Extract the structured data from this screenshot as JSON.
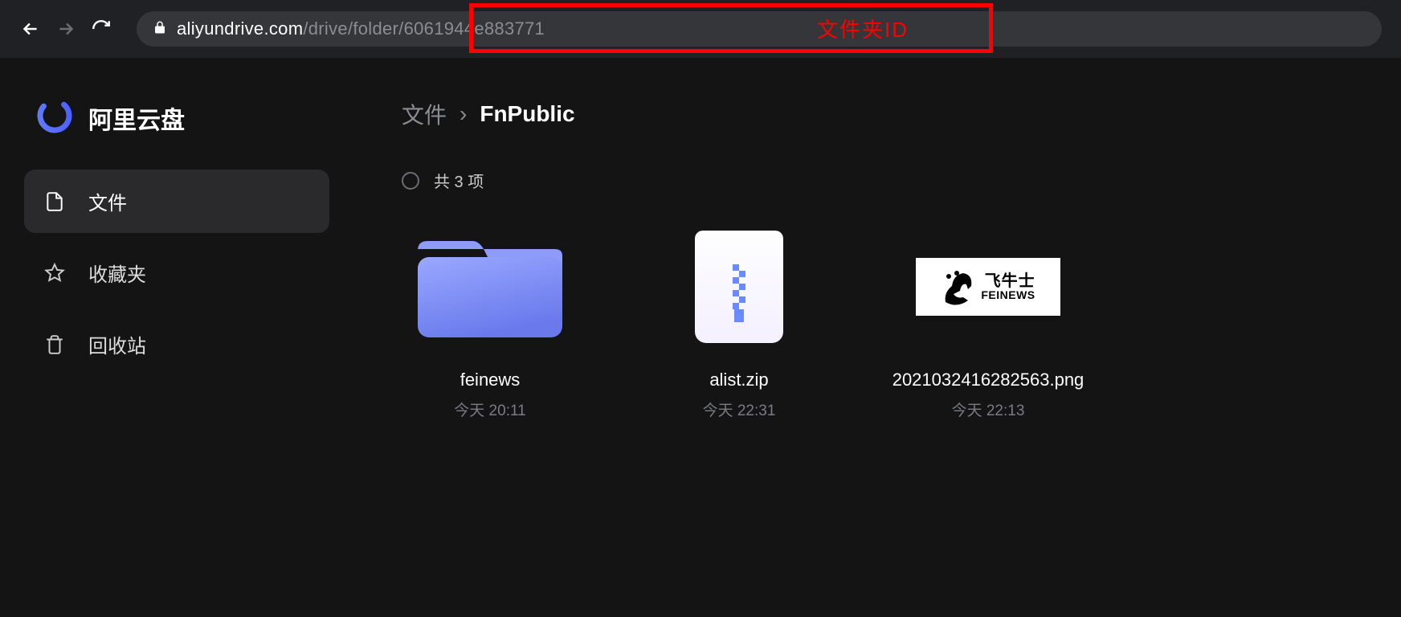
{
  "browser": {
    "url_host": "aliyundrive.com",
    "url_path": "/drive/folder/6061944e883771"
  },
  "annotation": {
    "label": "文件夹ID"
  },
  "brand": {
    "title": "阿里云盘"
  },
  "sidebar": {
    "items": [
      {
        "label": "文件",
        "icon": "file-icon"
      },
      {
        "label": "收藏夹",
        "icon": "star-icon"
      },
      {
        "label": "回收站",
        "icon": "trash-icon"
      }
    ]
  },
  "breadcrumb": {
    "root": "文件",
    "separator": "›",
    "current": "FnPublic"
  },
  "count": {
    "text": "共 3 项"
  },
  "items": [
    {
      "type": "folder",
      "name": "feinews",
      "time": "今天 20:11"
    },
    {
      "type": "zip",
      "name": "alist.zip",
      "time": "今天 22:31"
    },
    {
      "type": "image",
      "name": "2021032416282563.png",
      "time": "今天 22:13",
      "thumb_text_top": "飞牛士",
      "thumb_text_bottom": "FEINEWS"
    }
  ]
}
